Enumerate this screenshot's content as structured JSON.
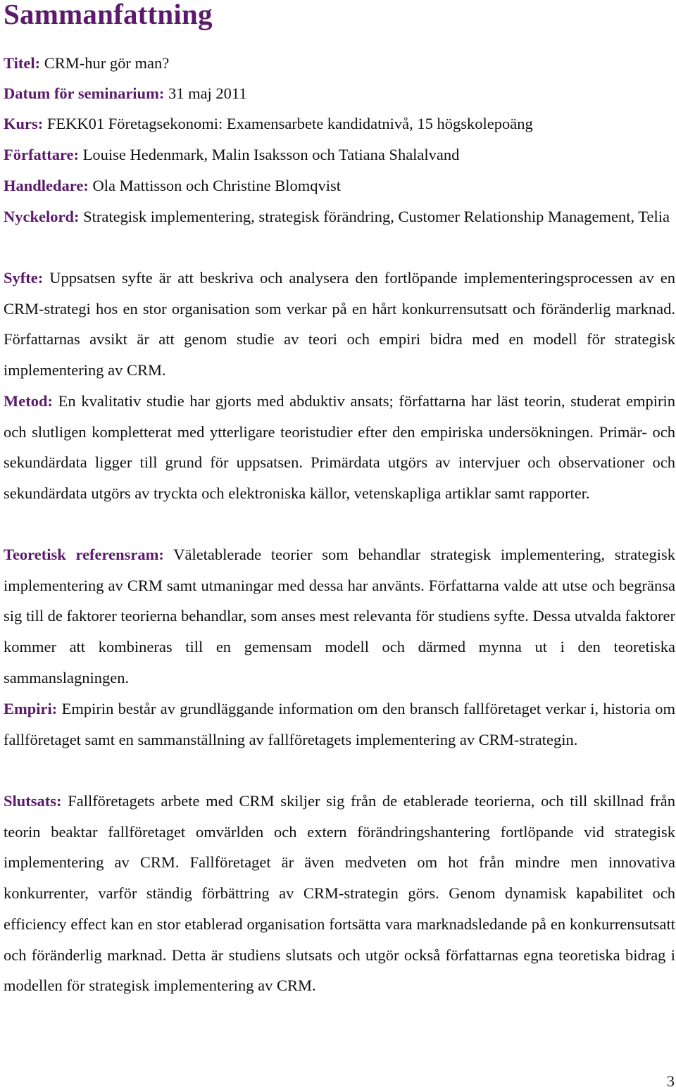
{
  "document": {
    "heading": "Sammanfattning",
    "colors": {
      "label": "#5b1a6c",
      "text": "#111111"
    },
    "fields": [
      {
        "label": "Titel:",
        "text": "CRM-hur gör man?"
      },
      {
        "label": "Datum för seminarium:",
        "text": "31 maj 2011"
      },
      {
        "label": "Kurs:",
        "text": "FEKK01 Företagsekonomi: Examensarbete kandidatnivå, 15 högskolepoäng"
      },
      {
        "label": "Författare:",
        "text": "Louise Hedenmark, Malin Isaksson och Tatiana Shalalvand"
      },
      {
        "label": "Handledare:",
        "text": "Ola Mattisson och Christine Blomqvist"
      },
      {
        "label": "Nyckelord:",
        "text": "Strategisk implementering, strategisk förändring, Customer Relationship Management, Telia"
      },
      {
        "label": "Syfte:",
        "text": "Uppsatsen syfte är att beskriva och analysera den fortlöpande implementeringsprocessen av en CRM-strategi hos en stor organisation som verkar på en hårt konkurrensutsatt och föränderlig marknad. Författarnas avsikt är att genom studie av teori och empiri bidra med en modell för strategisk implementering av CRM."
      },
      {
        "label": "Metod:",
        "text": "En kvalitativ studie har gjorts med abduktiv ansats; författarna har läst teorin, studerat empirin och slutligen kompletterat med ytterligare teoristudier efter den empiriska undersökningen. Primär- och sekundärdata ligger till grund för uppsatsen. Primärdata utgörs av intervjuer och observationer och sekundärdata utgörs av tryckta och elektroniska källor, vetenskapliga artiklar samt rapporter."
      },
      {
        "label": "Teoretisk referensram:",
        "text": "Väletablerade teorier som behandlar strategisk implementering, strategisk implementering av CRM samt utmaningar med dessa har använts. Författarna valde att utse och begränsa sig till de faktorer teorierna behandlar, som anses mest relevanta för studiens syfte. Dessa utvalda faktorer kommer att kombineras till en gemensam modell och därmed mynna ut i den teoretiska sammanslagningen."
      },
      {
        "label": "Empiri:",
        "text": "Empirin består av grundläggande information om den bransch fallföretaget verkar i, historia om fallföretaget samt en sammanställning av fallföretagets implementering av CRM-strategin."
      },
      {
        "label": "Slutsats:",
        "text": "Fallföretagets arbete med CRM skiljer sig från de etablerade teorierna, och till skillnad från teorin beaktar fallföretaget omvärlden och extern förändringshantering fortlöpande vid strategisk implementering av CRM. Fallföretaget är även medveten om hot från mindre men innovativa konkurrenter, varför ständig förbättring av CRM-strategin görs. Genom dynamisk kapabilitet och efficiency effect kan en stor etablerad organisation fortsätta vara marknadsledande på en konkurrensutsatt och föränderlig marknad. Detta är studiens slutsats och utgör också författarnas egna teoretiska bidrag i modellen för strategisk implementering av CRM."
      }
    ],
    "page_number": "3"
  }
}
